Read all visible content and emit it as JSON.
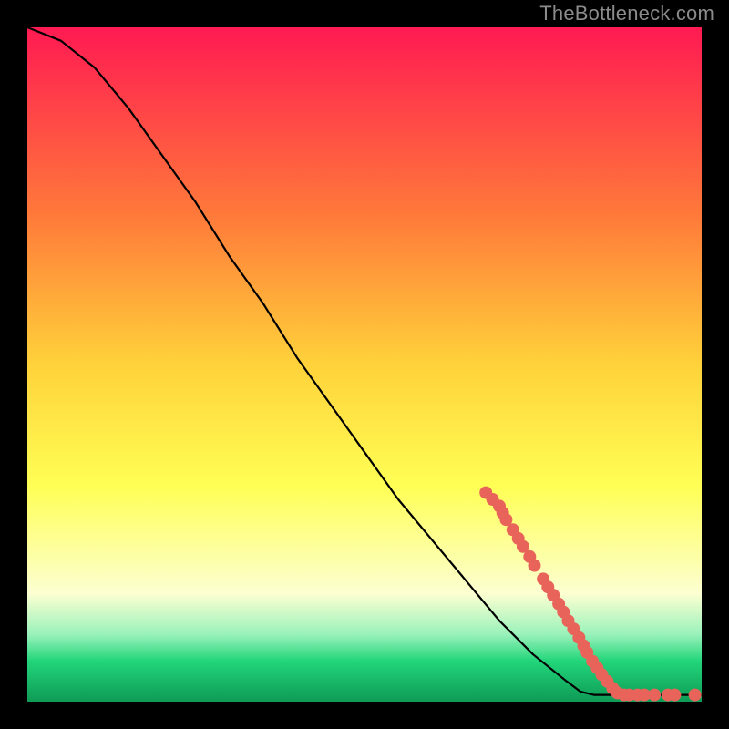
{
  "watermark": "TheBottleneck.com",
  "colors": {
    "bg_black": "#000000",
    "watermark_gray": "#8b8b8b",
    "curve_black": "#000000",
    "marker_fill": "#e8645a",
    "marker_stroke": "#c24c44",
    "grad_top": "#ff1a52",
    "grad_mid1": "#ff7a3a",
    "grad_mid2": "#ffd23a",
    "grad_mid3": "#ffff55",
    "grad_mid4": "#fcffd1",
    "grad_low_green_light": "#9af2bb",
    "grad_low_green": "#22d57a",
    "grad_bottom_green_dark": "#0e9b56"
  },
  "chart_data": {
    "type": "line",
    "title": "",
    "xlabel": "",
    "ylabel": "",
    "xlim": [
      0,
      100
    ],
    "ylim": [
      0,
      100
    ],
    "curve": {
      "name": "bottleneck-curve",
      "points": [
        {
          "x": 0,
          "y": 100
        },
        {
          "x": 5,
          "y": 98
        },
        {
          "x": 10,
          "y": 94
        },
        {
          "x": 15,
          "y": 88
        },
        {
          "x": 20,
          "y": 81
        },
        {
          "x": 25,
          "y": 74
        },
        {
          "x": 30,
          "y": 66
        },
        {
          "x": 35,
          "y": 59
        },
        {
          "x": 40,
          "y": 51
        },
        {
          "x": 45,
          "y": 44
        },
        {
          "x": 50,
          "y": 37
        },
        {
          "x": 55,
          "y": 30
        },
        {
          "x": 60,
          "y": 24
        },
        {
          "x": 65,
          "y": 18
        },
        {
          "x": 70,
          "y": 12
        },
        {
          "x": 75,
          "y": 7
        },
        {
          "x": 80,
          "y": 3
        },
        {
          "x": 82,
          "y": 1.5
        },
        {
          "x": 84,
          "y": 1
        },
        {
          "x": 90,
          "y": 1
        },
        {
          "x": 100,
          "y": 1
        }
      ]
    },
    "markers": [
      {
        "x": 68,
        "y": 31
      },
      {
        "x": 69,
        "y": 30
      },
      {
        "x": 70,
        "y": 29
      },
      {
        "x": 70.5,
        "y": 28
      },
      {
        "x": 71,
        "y": 27
      },
      {
        "x": 72,
        "y": 25.5
      },
      {
        "x": 72.8,
        "y": 24.2
      },
      {
        "x": 73.5,
        "y": 23
      },
      {
        "x": 74.5,
        "y": 21.5
      },
      {
        "x": 75.2,
        "y": 20.2
      },
      {
        "x": 76.5,
        "y": 18.2
      },
      {
        "x": 77.2,
        "y": 17
      },
      {
        "x": 78,
        "y": 15.8
      },
      {
        "x": 78.8,
        "y": 14.5
      },
      {
        "x": 79.5,
        "y": 13.3
      },
      {
        "x": 80.2,
        "y": 12
      },
      {
        "x": 81,
        "y": 10.8
      },
      {
        "x": 81.8,
        "y": 9.5
      },
      {
        "x": 82.5,
        "y": 8.3
      },
      {
        "x": 83,
        "y": 7.3
      },
      {
        "x": 83.8,
        "y": 6
      },
      {
        "x": 84.5,
        "y": 5
      },
      {
        "x": 85.2,
        "y": 4
      },
      {
        "x": 86,
        "y": 3
      },
      {
        "x": 86.8,
        "y": 2
      },
      {
        "x": 87.5,
        "y": 1.3
      },
      {
        "x": 88.5,
        "y": 1
      },
      {
        "x": 89.3,
        "y": 1
      },
      {
        "x": 90.5,
        "y": 1
      },
      {
        "x": 91.5,
        "y": 1
      },
      {
        "x": 93,
        "y": 1
      },
      {
        "x": 95,
        "y": 1
      },
      {
        "x": 96,
        "y": 1
      },
      {
        "x": 99,
        "y": 1
      }
    ]
  }
}
